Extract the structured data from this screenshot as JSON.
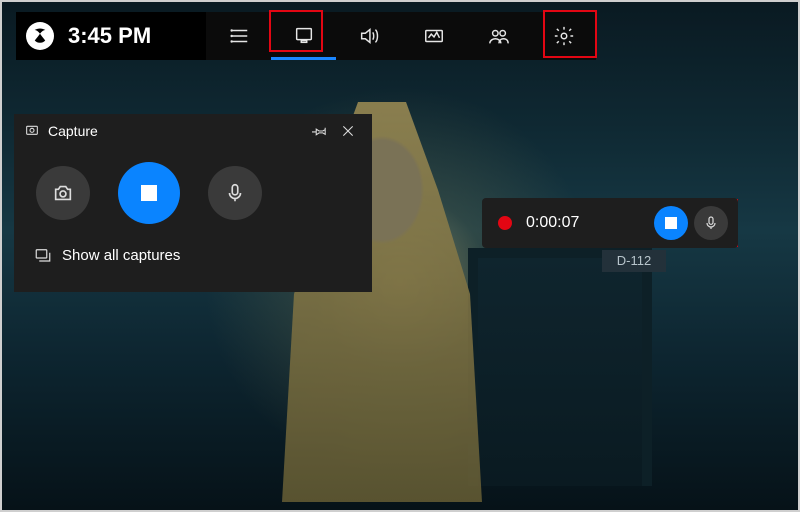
{
  "topbar": {
    "time": "3:45 PM",
    "icons": {
      "xbox": "xbox-logo-icon",
      "widgets": "widgets-menu-icon",
      "capture": "capture-icon",
      "audio": "audio-icon",
      "performance": "performance-icon",
      "social": "xbox-social-icon",
      "settings": "settings-gear-icon"
    },
    "active_index": 1
  },
  "capture_widget": {
    "title": "Capture",
    "buttons": {
      "screenshot_label": "screenshot",
      "stop_label": "stop-recording",
      "mic_label": "microphone-toggle"
    },
    "footer_label": "Show all captures"
  },
  "recording_bar": {
    "elapsed": "0:00:07",
    "recording": true
  },
  "scene": {
    "door_label": "D-112"
  },
  "colors": {
    "accent": "#0a84ff",
    "highlight": "#e30613",
    "panel": "#1e1e1e"
  }
}
